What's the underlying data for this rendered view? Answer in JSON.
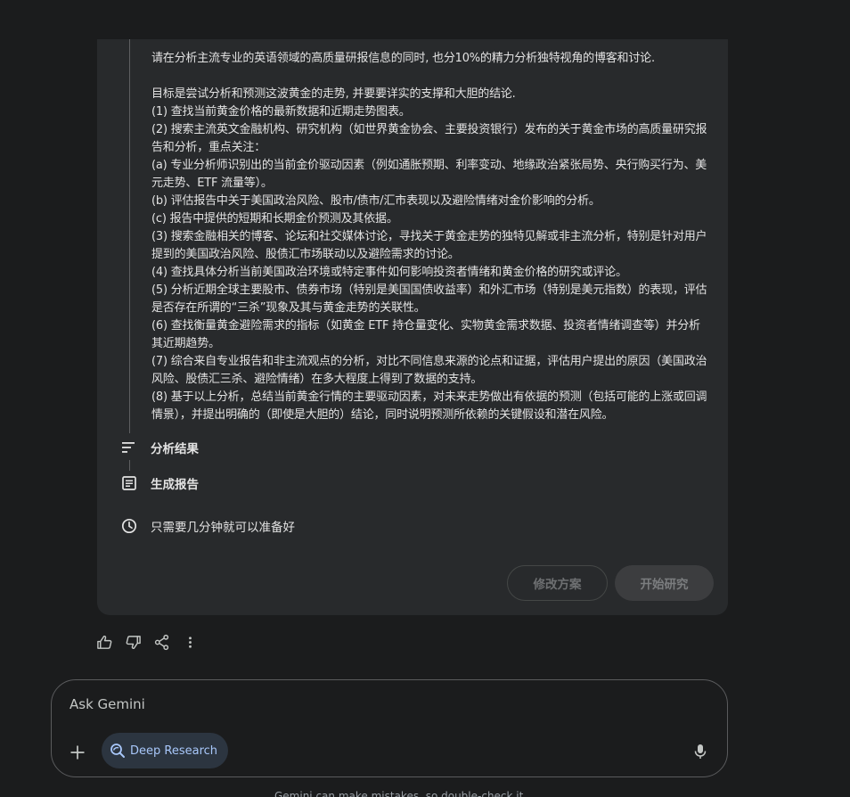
{
  "plan": {
    "lines": [
      "请在分析主流专业的英语领域的高质量研报信息的同时, 也分10%的精力分析独特视角的博客和讨论.",
      "",
      "目标是尝试分析和预测这波黄金的走势, 并要要详实的支撑和大胆的结论.",
      "(1) 查找当前黄金价格的最新数据和近期走势图表。",
      "(2) 搜索主流英文金融机构、研究机构（如世界黄金协会、主要投资银行）发布的关于黄金市场的高质量研究报告和分析，重点关注：",
      "(a) 专业分析师识别出的当前金价驱动因素（例如通胀预期、利率变动、地缘政治紧张局势、央行购买行为、美元走势、ETF 流量等）。",
      "(b) 评估报告中关于美国政治风险、股市/债市/汇市表现以及避险情绪对金价影响的分析。",
      "(c) 报告中提供的短期和长期金价预测及其依据。",
      "(3) 搜索金融相关的博客、论坛和社交媒体讨论，寻找关于黄金走势的独特见解或非主流分析，特别是针对用户提到的美国政治风险、股债汇市场联动以及避险需求的讨论。",
      "(4) 查找具体分析当前美国政治环境或特定事件如何影响投资者情绪和黄金价格的研究或评论。",
      "(5) 分析近期全球主要股市、债券市场（特别是美国国债收益率）和外汇市场（特别是美元指数）的表现，评估是否存在所谓的“三杀”现象及其与黄金走势的关联性。",
      "(6) 查找衡量黄金避险需求的指标（如黄金 ETF 持仓量变化、实物黄金需求数据、投资者情绪调查等）并分析其近期趋势。",
      "(7) 综合来自专业报告和非主流观点的分析，对比不同信息来源的论点和证据，评估用户提出的原因（美国政治风险、股债汇三杀、避险情绪）在多大程度上得到了数据的支持。",
      "(8) 基于以上分析，总结当前黄金行情的主要驱动因素，对未来走势做出有依据的预测（包括可能的上涨或回调情景），并提出明确的（即使是大胆的）结论，同时说明预测所依赖的关键假设和潜在风险。"
    ],
    "step_analysis": "分析结果",
    "step_report": "生成报告",
    "time_note": "只需要几分钟就可以准备好",
    "edit_label": "修改方案",
    "start_label": "开始研究"
  },
  "input": {
    "placeholder": "Ask Gemini",
    "tool_label": "Deep Research"
  },
  "disclaimer": "Gemini can make mistakes, so double-check it",
  "icons": {
    "analysis": "sort-lines-icon",
    "report": "document-icon",
    "time": "clock-icon",
    "like": "thumb-up-icon",
    "dislike": "thumb-down-icon",
    "share": "share-icon",
    "more": "more-vert-icon",
    "add": "plus-icon",
    "deep_research": "deep-research-icon",
    "mic": "mic-icon"
  },
  "colors": {
    "background": "#1b1c1d",
    "card": "#282a2c",
    "accent": "#a8c7fa"
  }
}
